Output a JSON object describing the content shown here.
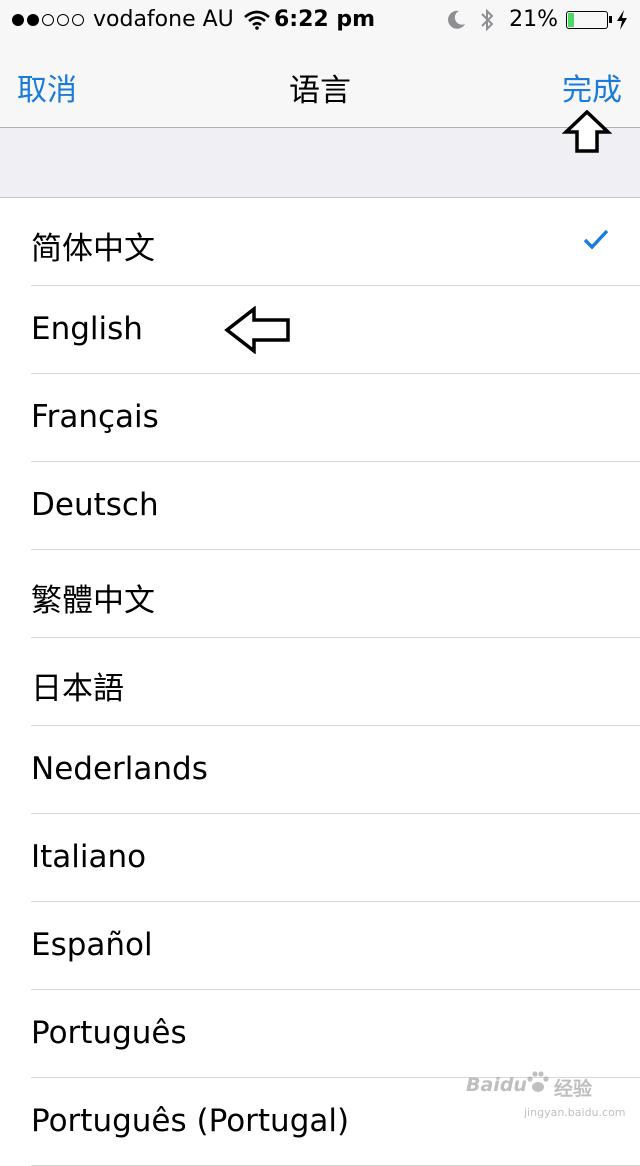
{
  "status_bar": {
    "signal_dots_filled": 2,
    "signal_dots_total": 5,
    "carrier": "vodafone AU",
    "time": "6:22 pm",
    "battery_percent": "21%",
    "battery_level": 0.21,
    "icons": [
      "wifi-icon",
      "moon-icon",
      "bluetooth-icon",
      "battery-icon",
      "charging-bolt-icon"
    ]
  },
  "nav": {
    "cancel_label": "取消",
    "title": "语言",
    "done_label": "完成"
  },
  "languages": [
    {
      "label": "简体中文",
      "selected": true
    },
    {
      "label": "English",
      "selected": false
    },
    {
      "label": "Français",
      "selected": false
    },
    {
      "label": "Deutsch",
      "selected": false
    },
    {
      "label": "繁體中文",
      "selected": false
    },
    {
      "label": "日本語",
      "selected": false
    },
    {
      "label": "Nederlands",
      "selected": false
    },
    {
      "label": "Italiano",
      "selected": false
    },
    {
      "label": "Español",
      "selected": false
    },
    {
      "label": "Português",
      "selected": false
    },
    {
      "label": "Português (Portugal)",
      "selected": false
    }
  ],
  "colors": {
    "accent": "#1a7bdb",
    "battery_fill": "#4cd964",
    "grouped_background": "#efeff4",
    "bar_background": "#f7f7f8"
  },
  "watermark": {
    "brand": "Baidu",
    "subtitle": "经验",
    "url": "jingyan.baidu.com"
  }
}
